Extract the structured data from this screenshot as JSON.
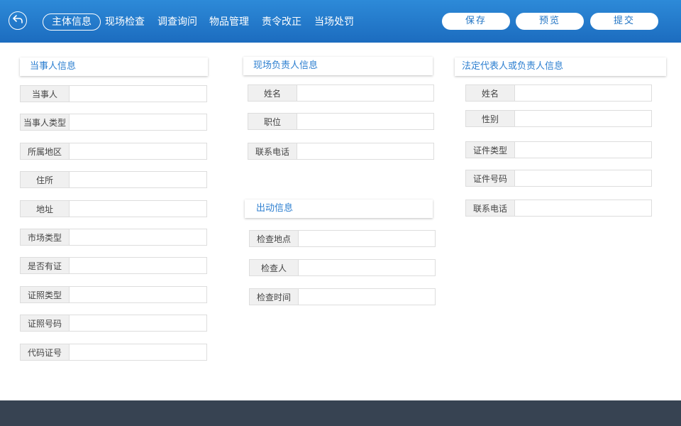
{
  "header": {
    "tabs": [
      "主体信息",
      "现场检查",
      "调查询问",
      "物品管理",
      "责令改正",
      "当场处罚"
    ],
    "active_tab": "主体信息",
    "buttons": {
      "save": "保存",
      "preview": "预览",
      "submit": "提交"
    }
  },
  "party_info": {
    "title": "当事人信息",
    "fields": [
      {
        "label": "当事人",
        "value": ""
      },
      {
        "label": "当事人类型",
        "value": ""
      },
      {
        "label": "所属地区",
        "value": ""
      },
      {
        "label": "住所",
        "value": ""
      },
      {
        "label": "地址",
        "value": ""
      },
      {
        "label": "市场类型",
        "value": ""
      },
      {
        "label": "是否有证",
        "value": ""
      },
      {
        "label": "证照类型",
        "value": ""
      },
      {
        "label": "证照号码",
        "value": ""
      },
      {
        "label": "代码证号",
        "value": ""
      }
    ]
  },
  "onsite_person": {
    "title": "现场负责人信息",
    "fields": [
      {
        "label": "姓名",
        "value": ""
      },
      {
        "label": "职位",
        "value": ""
      },
      {
        "label": "联系电话",
        "value": ""
      }
    ]
  },
  "dispatch_info": {
    "title": "出动信息",
    "fields": [
      {
        "label": "检查地点",
        "value": ""
      },
      {
        "label": "检查人",
        "value": ""
      },
      {
        "label": "检查时间",
        "value": ""
      }
    ]
  },
  "legal_rep": {
    "title": "法定代表人或负责人信息",
    "fields": [
      {
        "label": "姓名",
        "value": ""
      },
      {
        "label": "性别",
        "value": ""
      },
      {
        "label": "证件类型",
        "value": ""
      },
      {
        "label": "证件号码",
        "value": ""
      },
      {
        "label": "联系电话",
        "value": ""
      }
    ]
  }
}
